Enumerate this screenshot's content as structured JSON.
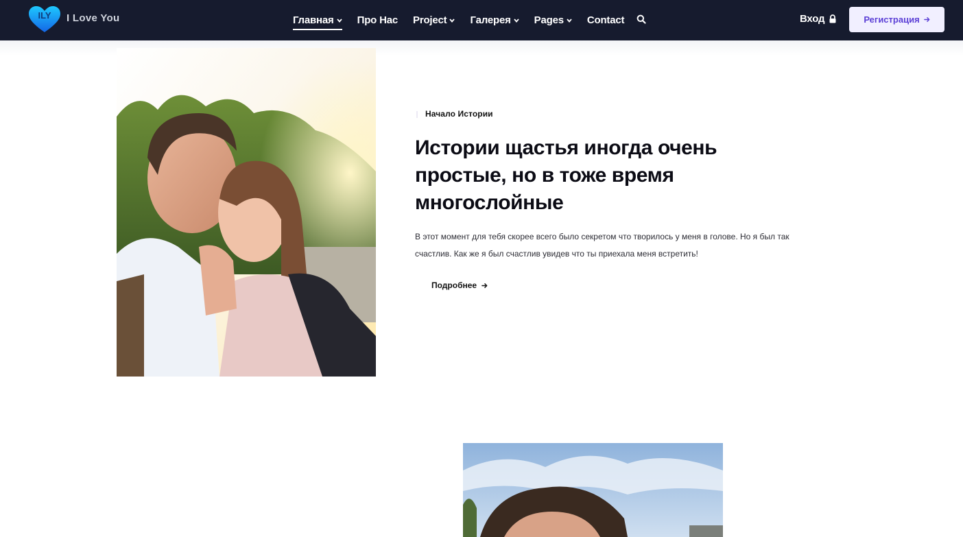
{
  "brand": {
    "logo_text": "I Love You",
    "logo_badge": "ILY",
    "colors": {
      "navbar": "#161b2e",
      "accent": "#5b3fd6",
      "button_bg": "#f1efff",
      "heart_top": "#1ec8ff",
      "heart_bottom": "#1466e6"
    }
  },
  "nav": {
    "items": [
      {
        "label": "Главная",
        "has_dropdown": true,
        "active": true
      },
      {
        "label": "Про Нас",
        "has_dropdown": false,
        "active": false
      },
      {
        "label": "Project",
        "has_dropdown": true,
        "active": false
      },
      {
        "label": "Галерея",
        "has_dropdown": true,
        "active": false
      },
      {
        "label": "Pages",
        "has_dropdown": true,
        "active": false
      },
      {
        "label": "Contact",
        "has_dropdown": false,
        "active": false
      }
    ],
    "search_icon": "search-icon",
    "login_label": "Вход",
    "login_icon": "lock-icon",
    "register_label": "Регистрация",
    "register_icon": "arrow-right-icon"
  },
  "story": {
    "eyebrow": "Начало Истории",
    "title": "Истории щастья иногда очень простые, но в тоже время многослойные",
    "description": "В этот момент для тебя скорее всего было секретом что творилось у меня в голове. Но я был так счастлив. Как же я был счастлив увидев что ты приехала меня встретить!",
    "more_label": "Подробнее",
    "more_icon": "arrow-right-icon"
  }
}
